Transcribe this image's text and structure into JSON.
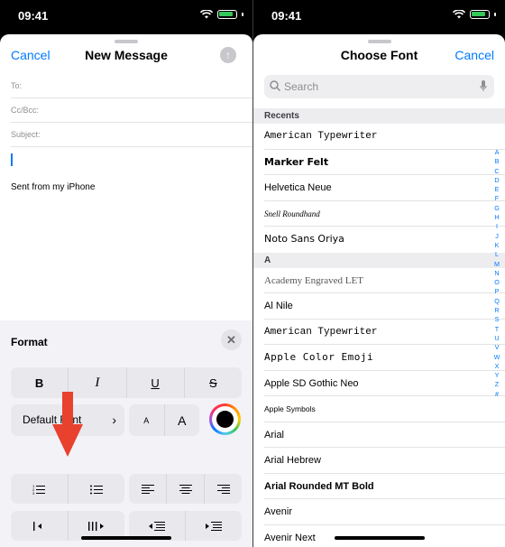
{
  "left": {
    "status": {
      "time": "09:41"
    },
    "nav": {
      "cancel": "Cancel",
      "title": "New Message",
      "send_icon": "up-arrow-icon"
    },
    "fields": {
      "to": "To:",
      "cc_bcc": "Cc/Bcc:",
      "subject": "Subject:"
    },
    "body": {
      "signature": "Sent from my iPhone"
    },
    "format": {
      "title": "Format",
      "close_icon": "close-icon",
      "style_buttons": [
        "B",
        "I",
        "U",
        "S"
      ],
      "font_button": "Default Font",
      "size_small": "A",
      "size_large": "A",
      "color_selected": "#000000",
      "list_icons": [
        "numbered-list-icon",
        "bulleted-list-icon"
      ],
      "align_icons": [
        "align-left-icon",
        "align-center-icon",
        "align-right-icon"
      ],
      "indent_icons": [
        "outdent-icon",
        "indent-icon"
      ],
      "quote_icons": [
        "decrease-quote-icon",
        "increase-quote-icon"
      ]
    },
    "annotation_color": "#e8412e"
  },
  "right": {
    "status": {
      "time": "09:41"
    },
    "nav": {
      "title": "Choose Font",
      "cancel": "Cancel"
    },
    "search": {
      "placeholder": "Search"
    },
    "sections": [
      {
        "header": "Recents",
        "items": [
          "American Typewriter",
          "Marker Felt",
          "Helvetica Neue",
          "Snell Roundhand",
          "Noto Sans Oriya"
        ]
      },
      {
        "header": "A",
        "items": [
          "Academy Engraved LET",
          "Al Nile",
          "American Typewriter",
          "Apple  Color  Emoji",
          "Apple SD Gothic Neo",
          "Apple Symbols",
          "Arial",
          "Arial Hebrew",
          "Arial Rounded MT Bold",
          "Avenir",
          "Avenir Next"
        ]
      }
    ],
    "index": [
      "A",
      "B",
      "C",
      "D",
      "E",
      "F",
      "G",
      "H",
      "I",
      "J",
      "K",
      "L",
      "M",
      "N",
      "O",
      "P",
      "Q",
      "R",
      "S",
      "T",
      "U",
      "V",
      "W",
      "X",
      "Y",
      "Z",
      "#"
    ]
  },
  "accent_color": "#007aff"
}
